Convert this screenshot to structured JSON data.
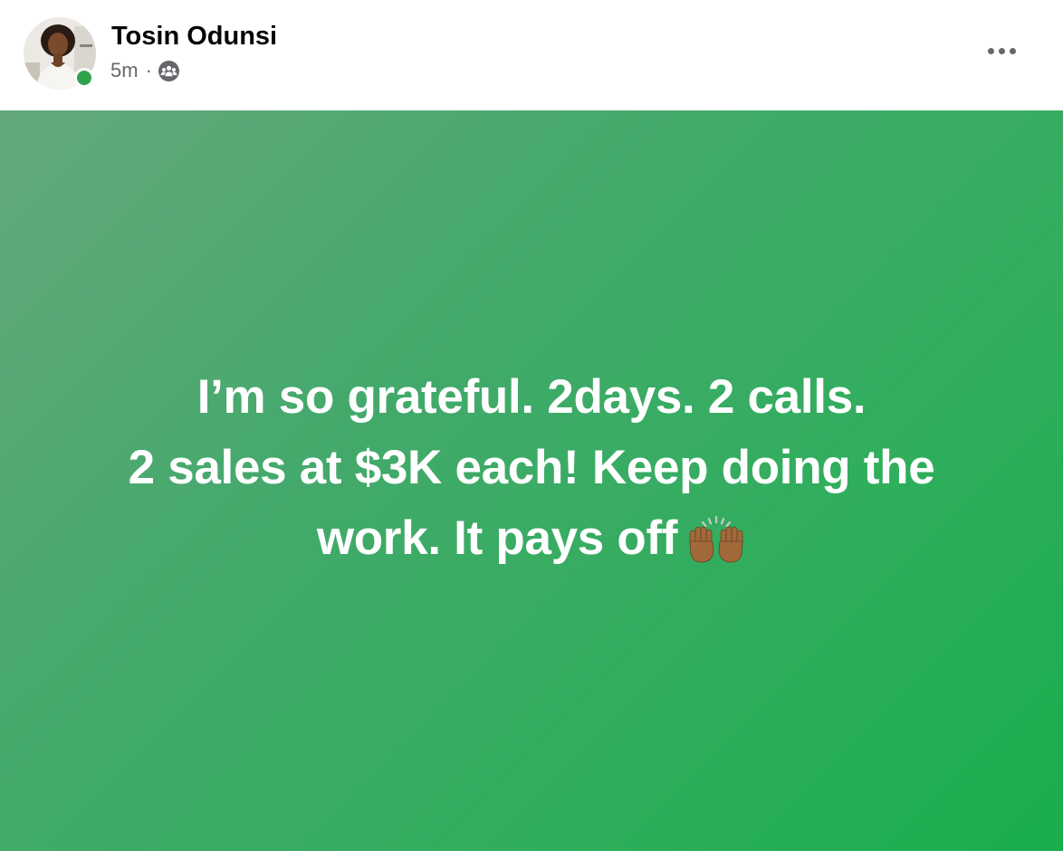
{
  "post": {
    "author_name": "Tosin Odunsi",
    "timestamp": "5m",
    "separator": "·",
    "audience_icon": "group-icon",
    "more_icon": "more-options-icon",
    "avatar": "profile-photo",
    "online_status": "online",
    "text_lines": [
      "I’m so grateful. 2days. 2 calls.",
      "2 sales at $3K each! Keep doing the",
      "work. It pays off"
    ],
    "emoji": "raised-hands-icon",
    "background_colors": [
      "#64a87c",
      "#1aad4c"
    ],
    "online_color": "#31a24c"
  }
}
